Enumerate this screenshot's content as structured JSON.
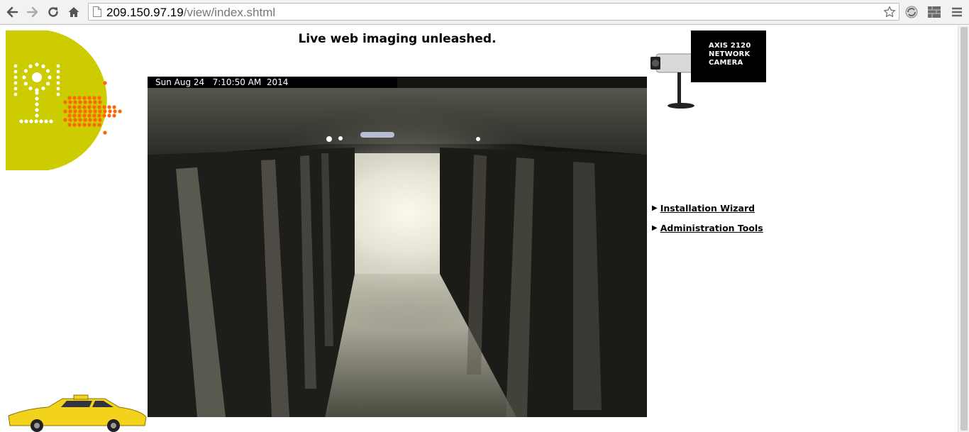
{
  "browser": {
    "url_host": "209.150.97.19",
    "url_path": "/view/index.shtml"
  },
  "page": {
    "headline": "Live web imaging unleashed.",
    "camera_badge": [
      "AXIS 2120",
      "NETWORK",
      "CAMERA"
    ],
    "video": {
      "timestamp": "Sun Aug 24   7:10:50 AM  2014"
    },
    "links": [
      {
        "label": "Installation Wizard"
      },
      {
        "label": "Administration Tools"
      }
    ]
  },
  "colors": {
    "logo_yellow": "#cccc00",
    "logo_orange": "#ff6600",
    "badge_black": "#000000"
  },
  "icons": [
    "back-icon",
    "forward-icon",
    "reload-icon",
    "home-icon",
    "page-icon",
    "star-icon",
    "extension-icon"
  ]
}
